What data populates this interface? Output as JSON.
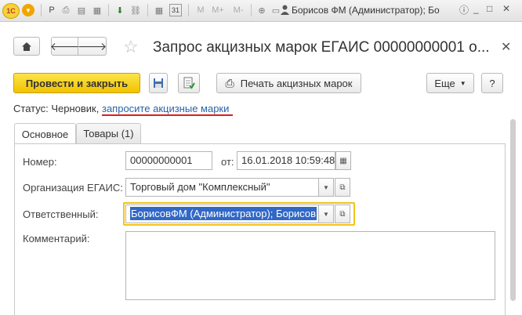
{
  "titlebar": {
    "logo_text": "1С",
    "text_p": "P",
    "m_label": "M",
    "mplus_label": "M+",
    "mminus_label": "M-",
    "calendar_day": "31",
    "user": "Борисов ФМ (Администратор); Бо"
  },
  "header": {
    "title": "Запрос акцизных марок ЕГАИС 00000000001 о..."
  },
  "toolbar": {
    "post_close": "Провести и закрыть",
    "print_marks": "Печать акцизных марок",
    "more": "Еще",
    "help": "?"
  },
  "status": {
    "label": "Статус:",
    "value": "Черновик,",
    "link": "запросите акцизные марки"
  },
  "tabs": [
    {
      "label": "Основное"
    },
    {
      "label": "Товары (1)"
    }
  ],
  "form": {
    "number_label": "Номер:",
    "number_value": "00000000001",
    "from_label": "от:",
    "date_value": "16.01.2018 10:59:48",
    "org_label": "Организация ЕГАИС:",
    "org_value": "Торговый дом \"Комплексный\"",
    "resp_label": "Ответственный:",
    "resp_value": "БорисовФМ (Администратор); Борисов",
    "comment_label": "Комментарий:",
    "comment_value": ""
  },
  "colors": {
    "accent": "#f2c200",
    "link": "#2862a8",
    "underline": "#e21b1b",
    "selection": "#3168c6"
  }
}
